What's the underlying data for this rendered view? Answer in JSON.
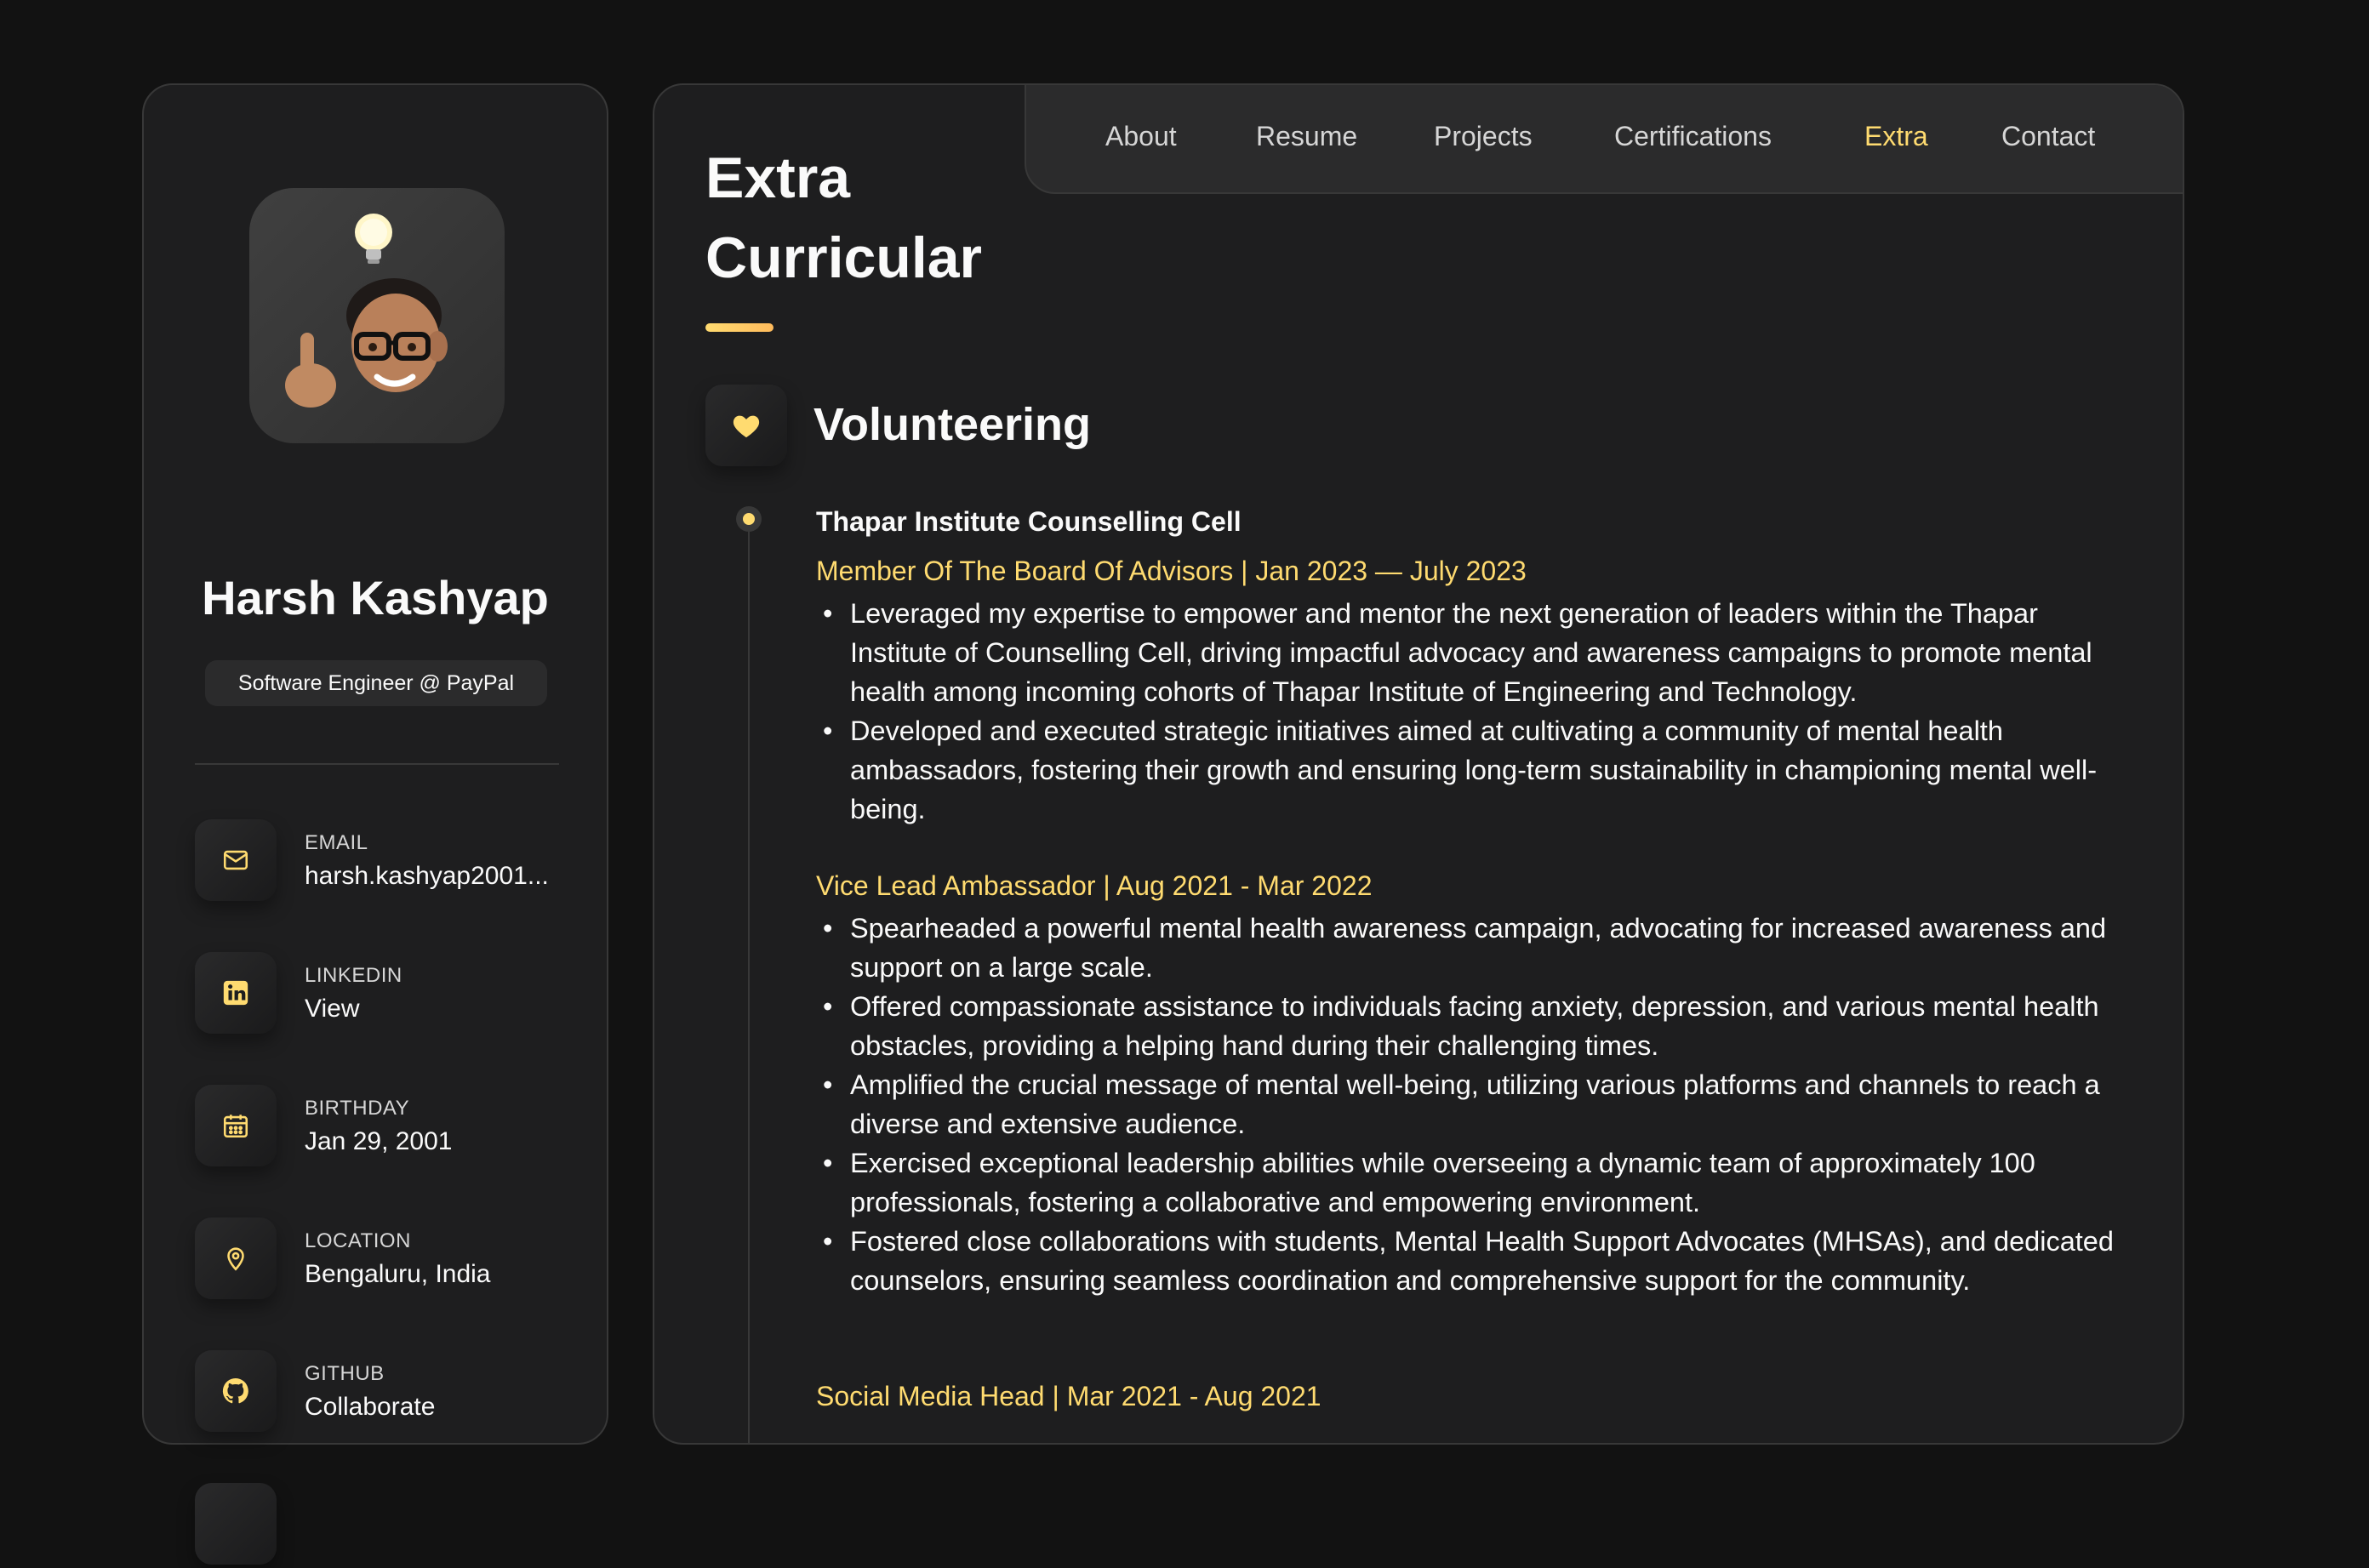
{
  "sidebar": {
    "name": "Harsh Kashyap",
    "role": "Software Engineer @ PayPal",
    "contacts": [
      {
        "label": "EMAIL",
        "value": "harsh.kashyap2001...",
        "icon": "mail-icon"
      },
      {
        "label": "LINKEDIN",
        "value": "View",
        "icon": "linkedin-icon"
      },
      {
        "label": "BIRTHDAY",
        "value": "Jan 29, 2001",
        "icon": "calendar-icon"
      },
      {
        "label": "LOCATION",
        "value": "Bengaluru, India",
        "icon": "location-pin-icon"
      },
      {
        "label": "GITHUB",
        "value": "Collaborate",
        "icon": "github-icon"
      }
    ]
  },
  "nav": {
    "items": [
      "About",
      "Resume",
      "Projects",
      "Certifications",
      "Extra",
      "Contact"
    ],
    "active": "Extra"
  },
  "article": {
    "title_line1": "Extra",
    "title_line2": "Curricular",
    "section": {
      "title": "Volunteering",
      "icon": "heart-icon",
      "org": "Thapar Institute Counselling Cell",
      "roles": [
        {
          "heading": "Member Of The Board Of Advisors | Jan 2023 — July 2023",
          "bullets": [
            "Leveraged my expertise to empower and mentor the next generation of leaders within the Thapar Institute of Counselling Cell, driving impactful advocacy and awareness campaigns to promote mental health among incoming cohorts of Thapar Institute of Engineering and Technology.",
            "Developed and executed strategic initiatives aimed at cultivating a community of mental health ambassadors, fostering their growth and ensuring long-term sustainability in championing mental well-being."
          ]
        },
        {
          "heading": "Vice Lead Ambassador | Aug 2021 - Mar 2022",
          "bullets": [
            "Spearheaded a powerful mental health awareness campaign, advocating for increased awareness and support on a large scale.",
            "Offered compassionate assistance to individuals facing anxiety, depression, and various mental health obstacles, providing a helping hand during their challenging times.",
            "Amplified the crucial message of mental well-being, utilizing various platforms and channels to reach a diverse and extensive audience.",
            "Exercised exceptional leadership abilities while overseeing a dynamic team of approximately 100 professionals, fostering a collaborative and empowering environment.",
            "Fostered close collaborations with students, Mental Health Support Advocates (MHSAs), and dedicated counselors, ensuring seamless coordination and comprehensive support for the community."
          ]
        },
        {
          "heading": "Social Media Head | Mar 2021 - Aug 2021",
          "bullets": []
        }
      ]
    }
  },
  "colors": {
    "accent": "#ffdb70",
    "background": "#121212",
    "card": "#1e1e1f",
    "border": "#383838"
  }
}
